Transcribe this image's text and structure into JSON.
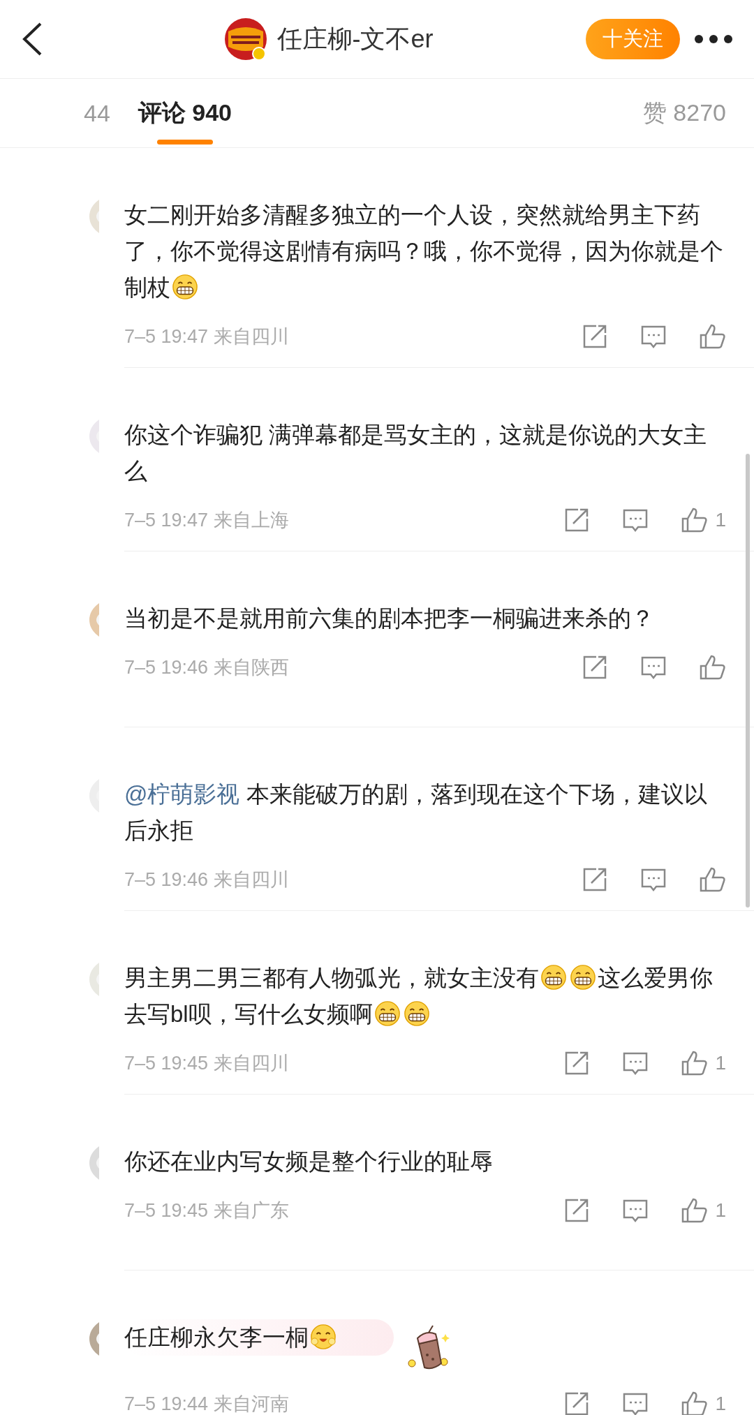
{
  "header": {
    "title": "任庄柳-文不er",
    "follow_button": "十关注"
  },
  "tabs": [
    {
      "label": "44",
      "selected": false
    },
    {
      "label": "评论 940",
      "selected": true
    }
  ],
  "likes_total": "赞 8270",
  "comments": [
    {
      "kind": "plain",
      "parts": [
        {
          "kind": "text",
          "text": "女二刚开始多清醒多独立的一个人设，突然就给男主下药了，你不觉得这剧情有病吗？哦，你不觉得，因为你就是个制杖"
        },
        {
          "kind": "grin"
        }
      ],
      "time": "7–5 19:47",
      "location": "来自四川"
    },
    {
      "kind": "plain",
      "parts": [
        {
          "kind": "text",
          "text": "你这个诈骗犯 满弹幕都是骂女主的，这就是你说的大女主么"
        }
      ],
      "time": "7–5 19:47",
      "location": "来自上海",
      "likes": "1"
    },
    {
      "kind": "plain",
      "parts": [
        {
          "kind": "text",
          "text": "当初是不是就用前六集的剧本把李一桐骗进来杀的？"
        }
      ],
      "time": "7–5 19:46",
      "location": "来自陕西"
    },
    {
      "kind": "plain",
      "parts": [
        {
          "kind": "mention",
          "text": "@柠萌影视"
        },
        {
          "kind": "text",
          "text": " 本来能破万的剧，落到现在这个下场，建议以后永拒"
        }
      ],
      "time": "7–5 19:46",
      "location": "来自四川"
    },
    {
      "kind": "plain",
      "parts": [
        {
          "kind": "text",
          "text": "男主男二男三都有人物弧光，就女主没有"
        },
        {
          "kind": "grin"
        },
        {
          "kind": "grin"
        },
        {
          "kind": "text",
          "text": "这么爱男你去写bl呗，写什么女频啊"
        },
        {
          "kind": "grin"
        },
        {
          "kind": "grin"
        }
      ],
      "time": "7–5 19:45",
      "location": "来自四川",
      "likes": "1"
    },
    {
      "kind": "plain",
      "parts": [
        {
          "kind": "text",
          "text": "你还在业内写女频是整个行业的耻辱"
        }
      ],
      "time": "7–5 19:45",
      "location": "来自广东",
      "likes": "1"
    },
    {
      "kind": "bubble",
      "parts": [
        {
          "kind": "text",
          "text": "任庄柳永欠李一桐"
        },
        {
          "kind": "blush"
        }
      ],
      "time": "7–5 19:44",
      "location": "来自河南",
      "likes": "1"
    }
  ]
}
